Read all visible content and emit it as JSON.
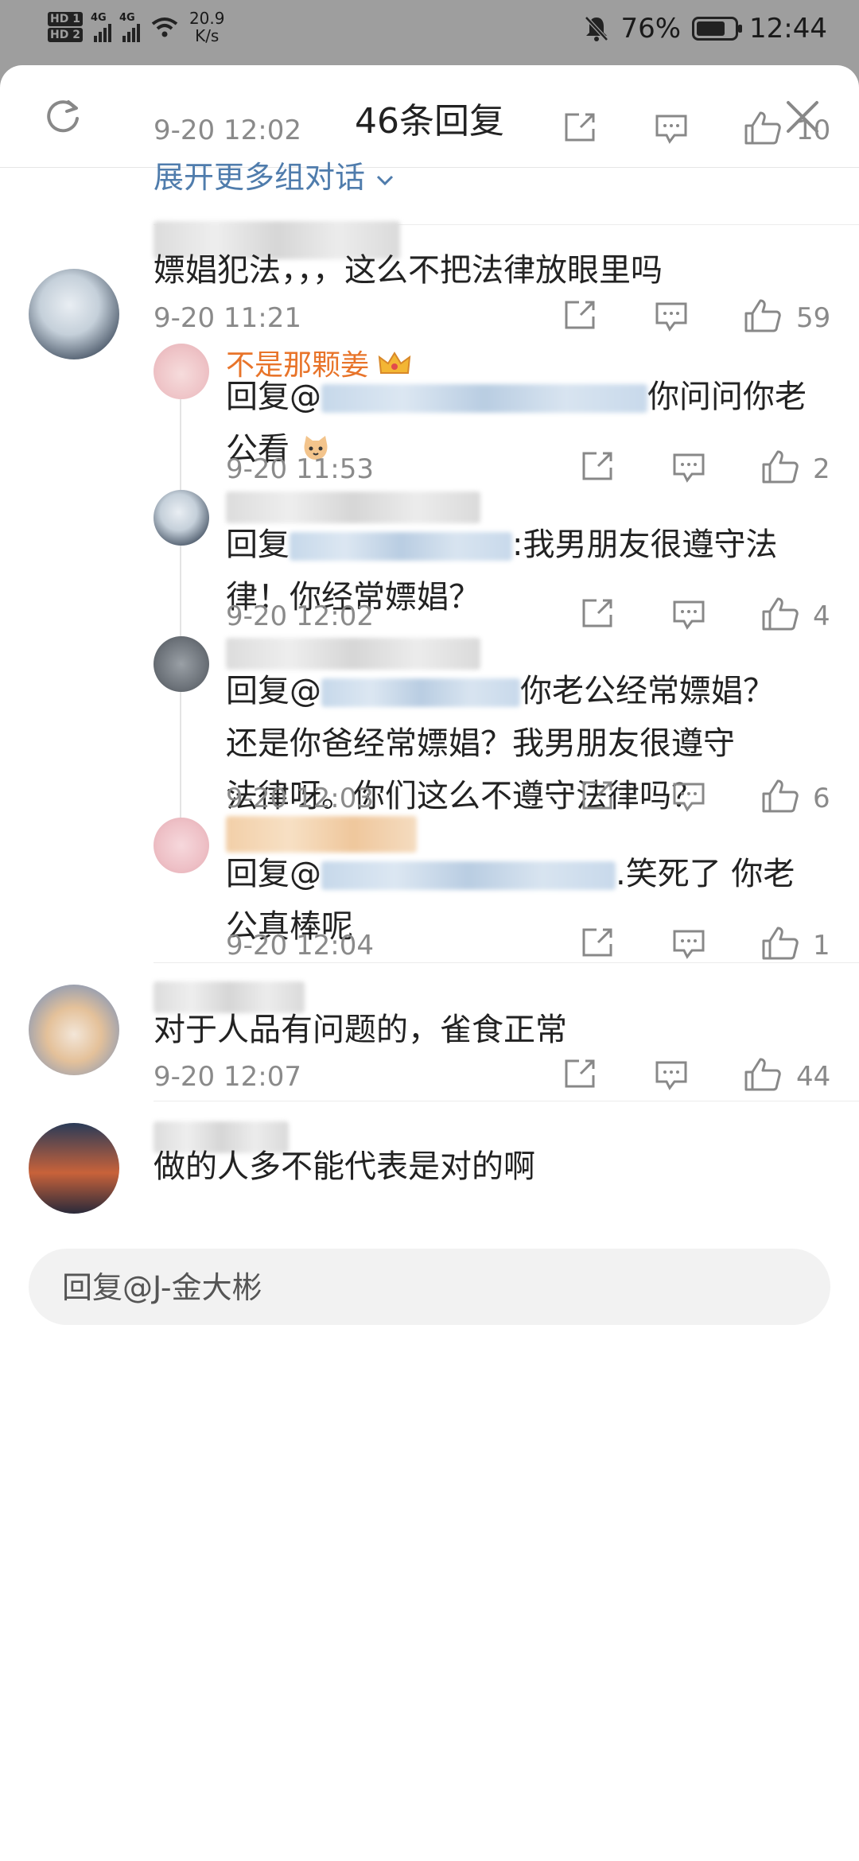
{
  "status_bar": {
    "hd1": "HD 1",
    "hd2": "HD 2",
    "net1": "4G",
    "net2": "4G",
    "speed_value": "20.9",
    "speed_unit": "K/s",
    "battery": "76%",
    "battery_level": 0.76,
    "time": "12:44"
  },
  "header": {
    "title": "46条回复"
  },
  "top_item": {
    "time": "9-20 12:02",
    "likes": "10",
    "expand": "展开更多组对话"
  },
  "comments": [
    {
      "text": "嫖娼犯法，，，这么不把法律放眼里吗",
      "time": "9-20 11:21",
      "likes": "59"
    },
    {
      "text": "对于人品有问题的，雀食正常",
      "time": "9-20 12:07",
      "likes": "44"
    },
    {
      "text": "做的人多不能代表是对的啊"
    }
  ],
  "replies": [
    {
      "name": "不是那颗姜",
      "prefix": "回复@",
      "line1": "你问问你老",
      "line2": "公看",
      "time": "9-20 11:53",
      "likes": "2"
    },
    {
      "prefix": "回复",
      "line1": ":我男朋友很遵守法",
      "line2": "律！你经常嫖娼？",
      "time": "9-20 12:02",
      "likes": "4"
    },
    {
      "prefix": "回复@",
      "line1": "你老公经常嫖娼？",
      "line2": "还是你爸经常嫖娼？我男朋友很遵守",
      "line3": "法律呀。你们这么不遵守法律吗？",
      "time": "9-20 12:03",
      "likes": "6"
    },
    {
      "prefix": "回复@",
      "line1": ".笑死了 你老",
      "line2": "公真棒呢",
      "time": "9-20 12:04",
      "likes": "1"
    }
  ],
  "reply_input": {
    "placeholder": "回复@J-金大彬"
  }
}
